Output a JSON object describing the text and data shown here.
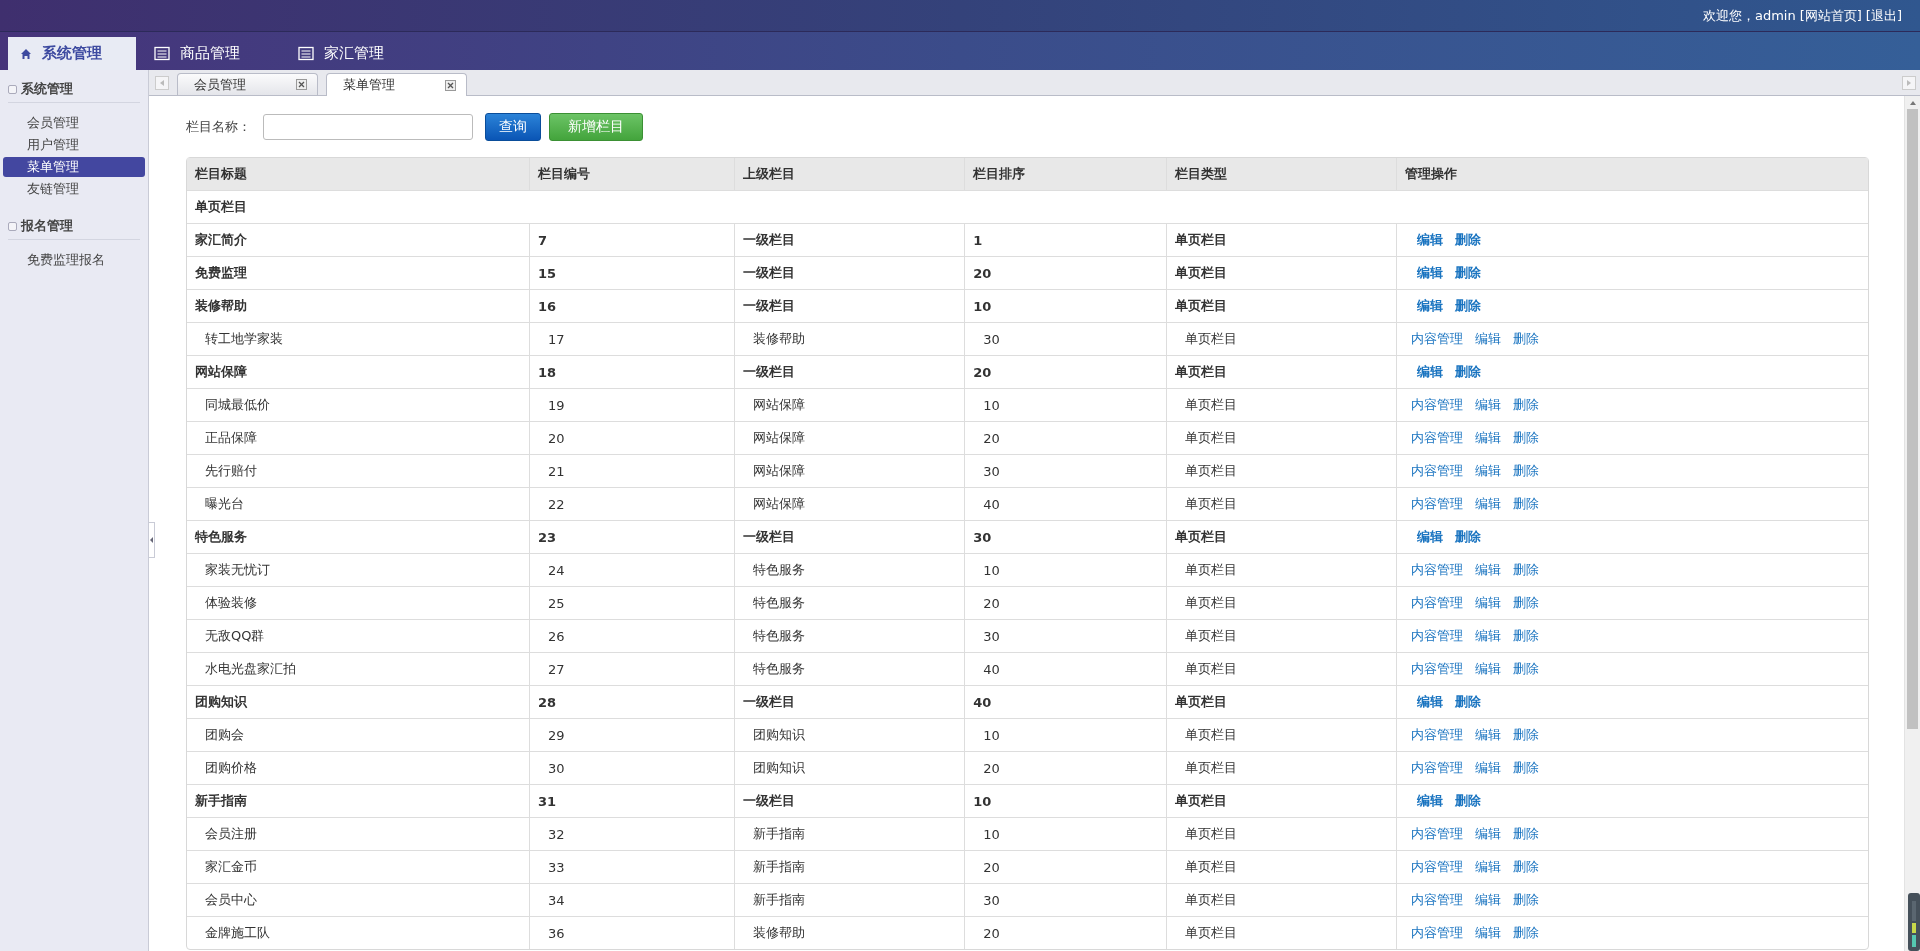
{
  "header": {
    "welcome": "欢迎您，admin",
    "links": [
      "[网站首页]",
      "[退出]"
    ]
  },
  "nav_tabs": [
    {
      "label": "系统管理",
      "selected": true,
      "kind": "home"
    },
    {
      "label": "商品管理",
      "selected": false,
      "kind": "list"
    },
    {
      "label": "家汇管理",
      "selected": false,
      "kind": "list"
    }
  ],
  "sidebar": [
    {
      "title": "系统管理",
      "items": [
        {
          "label": "会员管理",
          "selected": false
        },
        {
          "label": "用户管理",
          "selected": false
        },
        {
          "label": "菜单管理",
          "selected": true
        },
        {
          "label": "友链管理",
          "selected": false
        }
      ]
    },
    {
      "title": "报名管理",
      "items": [
        {
          "label": "免费监理报名",
          "selected": false
        }
      ]
    }
  ],
  "page_tabs": [
    {
      "label": "会员管理",
      "selected": false
    },
    {
      "label": "菜单管理",
      "selected": true
    }
  ],
  "search": {
    "label": "栏目名称："
  },
  "buttons": [
    {
      "label": "查询",
      "kind": "primary"
    },
    {
      "label": "新增栏目",
      "kind": "success"
    }
  ],
  "table": {
    "columns": [
      "栏目标题",
      "栏目编号",
      "上级栏目",
      "栏目排序",
      "栏目类型",
      "管理操作"
    ],
    "rows": [
      {
        "kind": "section",
        "title": "单页栏目"
      },
      {
        "kind": "group",
        "title": "家汇简介",
        "id": "7",
        "parent": "一级栏目",
        "order": "1",
        "type": "单页栏目",
        "actions": [
          "编辑",
          "删除"
        ]
      },
      {
        "kind": "group",
        "title": "免费监理",
        "id": "15",
        "parent": "一级栏目",
        "order": "20",
        "type": "单页栏目",
        "actions": [
          "编辑",
          "删除"
        ]
      },
      {
        "kind": "group",
        "title": "装修帮助",
        "id": "16",
        "parent": "一级栏目",
        "order": "10",
        "type": "单页栏目",
        "actions": [
          "编辑",
          "删除"
        ]
      },
      {
        "kind": "child",
        "title": "转工地学家装",
        "id": "17",
        "parent": "装修帮助",
        "order": "30",
        "type": "单页栏目",
        "actions": [
          "内容管理",
          "编辑",
          "删除"
        ]
      },
      {
        "kind": "group",
        "title": "网站保障",
        "id": "18",
        "parent": "一级栏目",
        "order": "20",
        "type": "单页栏目",
        "actions": [
          "编辑",
          "删除"
        ]
      },
      {
        "kind": "child",
        "title": "同城最低价",
        "id": "19",
        "parent": "网站保障",
        "order": "10",
        "type": "单页栏目",
        "actions": [
          "内容管理",
          "编辑",
          "删除"
        ]
      },
      {
        "kind": "child",
        "title": "正品保障",
        "id": "20",
        "parent": "网站保障",
        "order": "20",
        "type": "单页栏目",
        "actions": [
          "内容管理",
          "编辑",
          "删除"
        ]
      },
      {
        "kind": "child",
        "title": "先行赔付",
        "id": "21",
        "parent": "网站保障",
        "order": "30",
        "type": "单页栏目",
        "actions": [
          "内容管理",
          "编辑",
          "删除"
        ]
      },
      {
        "kind": "child",
        "title": "曝光台",
        "id": "22",
        "parent": "网站保障",
        "order": "40",
        "type": "单页栏目",
        "actions": [
          "内容管理",
          "编辑",
          "删除"
        ]
      },
      {
        "kind": "group",
        "title": "特色服务",
        "id": "23",
        "parent": "一级栏目",
        "order": "30",
        "type": "单页栏目",
        "actions": [
          "编辑",
          "删除"
        ]
      },
      {
        "kind": "child",
        "title": "家装无忧订",
        "id": "24",
        "parent": "特色服务",
        "order": "10",
        "type": "单页栏目",
        "actions": [
          "内容管理",
          "编辑",
          "删除"
        ]
      },
      {
        "kind": "child",
        "title": "体验装修",
        "id": "25",
        "parent": "特色服务",
        "order": "20",
        "type": "单页栏目",
        "actions": [
          "内容管理",
          "编辑",
          "删除"
        ]
      },
      {
        "kind": "child",
        "title": "无敌QQ群",
        "id": "26",
        "parent": "特色服务",
        "order": "30",
        "type": "单页栏目",
        "actions": [
          "内容管理",
          "编辑",
          "删除"
        ]
      },
      {
        "kind": "child",
        "title": "水电光盘家汇拍",
        "id": "27",
        "parent": "特色服务",
        "order": "40",
        "type": "单页栏目",
        "actions": [
          "内容管理",
          "编辑",
          "删除"
        ]
      },
      {
        "kind": "group",
        "title": "团购知识",
        "id": "28",
        "parent": "一级栏目",
        "order": "40",
        "type": "单页栏目",
        "actions": [
          "编辑",
          "删除"
        ]
      },
      {
        "kind": "child",
        "title": "团购会",
        "id": "29",
        "parent": "团购知识",
        "order": "10",
        "type": "单页栏目",
        "actions": [
          "内容管理",
          "编辑",
          "删除"
        ]
      },
      {
        "kind": "child",
        "title": "团购价格",
        "id": "30",
        "parent": "团购知识",
        "order": "20",
        "type": "单页栏目",
        "actions": [
          "内容管理",
          "编辑",
          "删除"
        ]
      },
      {
        "kind": "group",
        "title": "新手指南",
        "id": "31",
        "parent": "一级栏目",
        "order": "10",
        "type": "单页栏目",
        "actions": [
          "编辑",
          "删除"
        ]
      },
      {
        "kind": "child",
        "title": "会员注册",
        "id": "32",
        "parent": "新手指南",
        "order": "10",
        "type": "单页栏目",
        "actions": [
          "内容管理",
          "编辑",
          "删除"
        ]
      },
      {
        "kind": "child",
        "title": "家汇金币",
        "id": "33",
        "parent": "新手指南",
        "order": "20",
        "type": "单页栏目",
        "actions": [
          "内容管理",
          "编辑",
          "删除"
        ]
      },
      {
        "kind": "child",
        "title": "会员中心",
        "id": "34",
        "parent": "新手指南",
        "order": "30",
        "type": "单页栏目",
        "actions": [
          "内容管理",
          "编辑",
          "删除"
        ]
      },
      {
        "kind": "child",
        "title": "金牌施工队",
        "id": "36",
        "parent": "装修帮助",
        "order": "20",
        "type": "单页栏目",
        "actions": [
          "内容管理",
          "编辑",
          "删除"
        ]
      }
    ]
  }
}
